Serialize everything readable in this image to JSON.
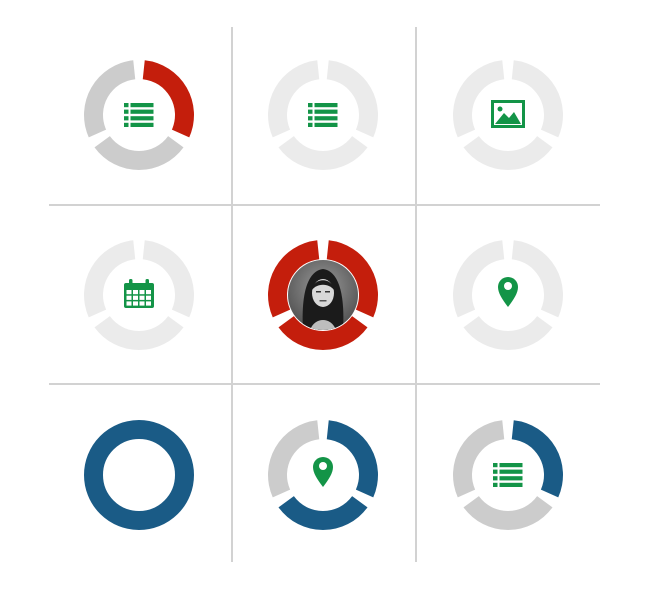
{
  "colors": {
    "red": "#c41e0c",
    "blue": "#1a5b86",
    "gray": "#cccccc",
    "light": "#ebebeb",
    "icon_green": "#139447",
    "grid_line": "#d2d2d2"
  },
  "widgets": [
    {
      "segments": [
        {
          "color": "red"
        },
        {
          "color": "gray"
        },
        {
          "color": "gray"
        }
      ],
      "icon": "list-icon"
    },
    {
      "segments": [
        {
          "color": "light"
        },
        {
          "color": "light"
        },
        {
          "color": "light"
        }
      ],
      "icon": "list-icon"
    },
    {
      "segments": [
        {
          "color": "light"
        },
        {
          "color": "light"
        },
        {
          "color": "light"
        }
      ],
      "icon": "image-icon"
    },
    {
      "segments": [
        {
          "color": "light"
        },
        {
          "color": "light"
        },
        {
          "color": "light"
        }
      ],
      "icon": "calendar-icon"
    },
    {
      "segments": [
        {
          "color": "red"
        },
        {
          "color": "red"
        },
        {
          "color": "red"
        }
      ],
      "icon": "avatar-photo"
    },
    {
      "segments": [
        {
          "color": "light"
        },
        {
          "color": "light"
        },
        {
          "color": "light"
        }
      ],
      "icon": "map-pin-icon"
    },
    {
      "segments": "full",
      "ring_color": "blue",
      "icon": "none"
    },
    {
      "segments": [
        {
          "color": "blue"
        },
        {
          "color": "blue"
        },
        {
          "color": "gray"
        }
      ],
      "icon": "map-pin-icon"
    },
    {
      "segments": [
        {
          "color": "blue"
        },
        {
          "color": "gray"
        },
        {
          "color": "gray"
        }
      ],
      "icon": "list-icon"
    }
  ]
}
